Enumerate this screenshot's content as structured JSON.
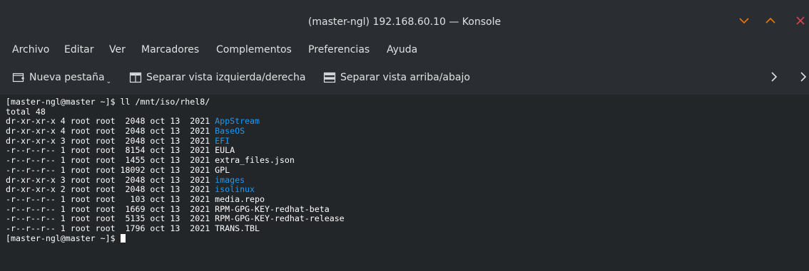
{
  "window": {
    "title": "(master-ngl) 192.168.60.10 — Konsole",
    "controls": {
      "minimize_icon": "chevron-down-icon",
      "maximize_icon": "chevron-up-icon",
      "close_icon": "close-icon",
      "minimize_color": "#f67400",
      "maximize_color": "#f67400",
      "close_color": "#da4453"
    }
  },
  "menubar": {
    "items": [
      "Archivo",
      "Editar",
      "Ver",
      "Marcadores",
      "Complementos",
      "Preferencias",
      "Ayuda"
    ]
  },
  "toolbar": {
    "new_tab_label": "Nueva pestaña",
    "split_lr_label": "Separar vista izquierda/derecha",
    "split_tb_label": "Separar vista arriba/abajo",
    "new_tab_icon": "new-tab-icon",
    "split_lr_icon": "split-left-right-icon",
    "split_tb_icon": "split-top-bottom-icon",
    "overflow_icons": [
      "chevron-right-icon",
      "chevron-right-icon"
    ]
  },
  "terminal": {
    "colors": {
      "background": "#232629",
      "text": "#fcfcfc",
      "directory": "#1d99f3"
    },
    "command_line": "[master-ngl@master ~]$ ll /mnt/iso/rhel8/",
    "total_line": "total 48",
    "entries": [
      {
        "meta": "dr-xr-xr-x 4 root root  2048 oct 13  2021 ",
        "name": "AppStream",
        "is_dir": true
      },
      {
        "meta": "dr-xr-xr-x 4 root root  2048 oct 13  2021 ",
        "name": "BaseOS",
        "is_dir": true
      },
      {
        "meta": "dr-xr-xr-x 3 root root  2048 oct 13  2021 ",
        "name": "EFI",
        "is_dir": true
      },
      {
        "meta": "-r--r--r-- 1 root root  8154 oct 13  2021 ",
        "name": "EULA",
        "is_dir": false
      },
      {
        "meta": "-r--r--r-- 1 root root  1455 oct 13  2021 ",
        "name": "extra_files.json",
        "is_dir": false
      },
      {
        "meta": "-r--r--r-- 1 root root 18092 oct 13  2021 ",
        "name": "GPL",
        "is_dir": false
      },
      {
        "meta": "dr-xr-xr-x 3 root root  2048 oct 13  2021 ",
        "name": "images",
        "is_dir": true
      },
      {
        "meta": "dr-xr-xr-x 2 root root  2048 oct 13  2021 ",
        "name": "isolinux",
        "is_dir": true
      },
      {
        "meta": "-r--r--r-- 1 root root   103 oct 13  2021 ",
        "name": "media.repo",
        "is_dir": false
      },
      {
        "meta": "-r--r--r-- 1 root root  1669 oct 13  2021 ",
        "name": "RPM-GPG-KEY-redhat-beta",
        "is_dir": false
      },
      {
        "meta": "-r--r--r-- 1 root root  5135 oct 13  2021 ",
        "name": "RPM-GPG-KEY-redhat-release",
        "is_dir": false
      },
      {
        "meta": "-r--r--r-- 1 root root  1796 oct 13  2021 ",
        "name": "TRANS.TBL",
        "is_dir": false
      }
    ],
    "prompt_line": "[master-ngl@master ~]$ "
  }
}
